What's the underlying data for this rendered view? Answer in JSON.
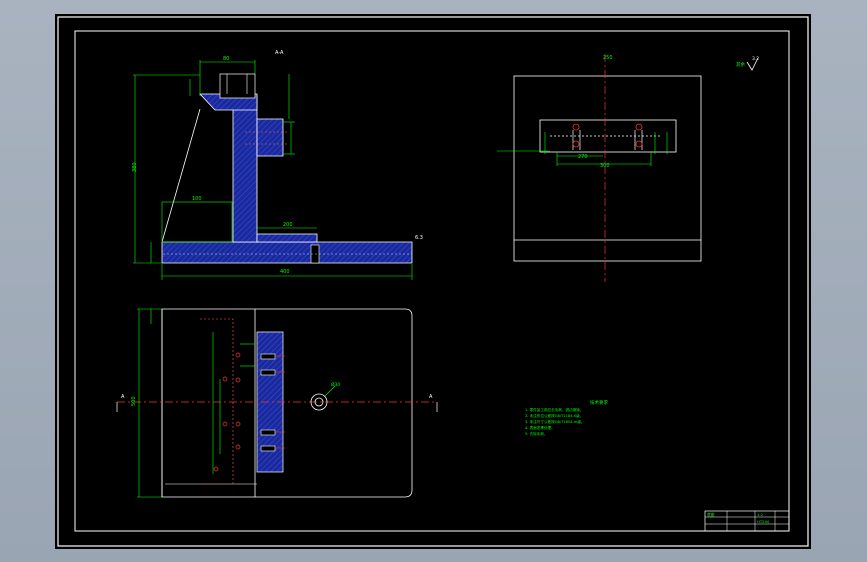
{
  "colors": {
    "background": "#a9b3c0",
    "sheet": "#000000",
    "border": "#ffffff",
    "dimension": "#00ff00",
    "section_fill": "#1a2a9e",
    "centerline": "#ff3030",
    "hole_marker": "#ff3030"
  },
  "section_view": {
    "label": "A-A",
    "dim_top_width": "80",
    "dim_height": "380",
    "dim_base_width": "400",
    "dim_mid_width": "100",
    "dim_web": "200",
    "roughness": "6.3"
  },
  "side_view": {
    "dim_top": "250",
    "dim_bottom": "300",
    "dim_hole": "270",
    "roughness": "3.2"
  },
  "plan_view": {
    "dim_width": "500",
    "dim_hole": "Ø30",
    "section_mark_left": "A",
    "section_mark_right": "A"
  },
  "notes": {
    "heading": "技术要求",
    "items": [
      "1. 零件加工前应去毛刺、锐边倒钝。",
      "2. 未注形位公差按GB/T1184-K级。",
      "3. 未注尺寸公差按GB/T1804-m级。",
      "4. 表面发黑处理。",
      "5. 去除毛刺。"
    ]
  },
  "title_block": {
    "name": "底座",
    "scale": "1:2",
    "material": "HT200"
  },
  "general_roughness": "其余"
}
